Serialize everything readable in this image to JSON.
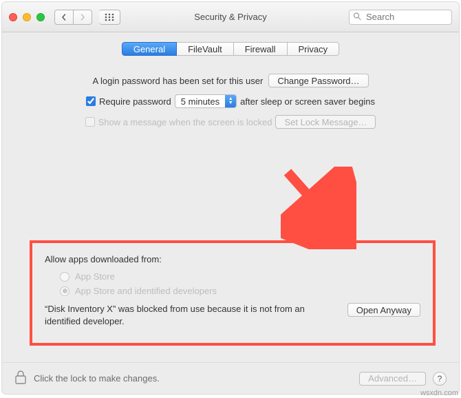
{
  "window_title": "Security & Privacy",
  "search": {
    "placeholder": "Search"
  },
  "tabs": [
    {
      "label": "General",
      "active": true
    },
    {
      "label": "FileVault",
      "active": false
    },
    {
      "label": "Firewall",
      "active": false
    },
    {
      "label": "Privacy",
      "active": false
    }
  ],
  "login": {
    "text": "A login password has been set for this user",
    "change_btn": "Change Password…"
  },
  "require": {
    "checked": true,
    "label": "Require password",
    "select_value": "5 minutes",
    "after_label": "after sleep or screen saver begins"
  },
  "show_message": {
    "checked": false,
    "label": "Show a message when the screen is locked",
    "set_btn": "Set Lock Message…"
  },
  "allow": {
    "heading": "Allow apps downloaded from:",
    "options": [
      {
        "label": "App Store",
        "selected": false
      },
      {
        "label": "App Store and identified developers",
        "selected": true
      }
    ],
    "blocked_text": "“Disk Inventory X” was blocked from use because it is not from an identified developer.",
    "open_btn": "Open Anyway"
  },
  "footer": {
    "lock_text": "Click the lock to make changes.",
    "advanced_btn": "Advanced…"
  },
  "colors": {
    "highlight_box": "#ff4f42",
    "accent_blue": "#2a7de0"
  },
  "watermark": "wsxdn.com"
}
